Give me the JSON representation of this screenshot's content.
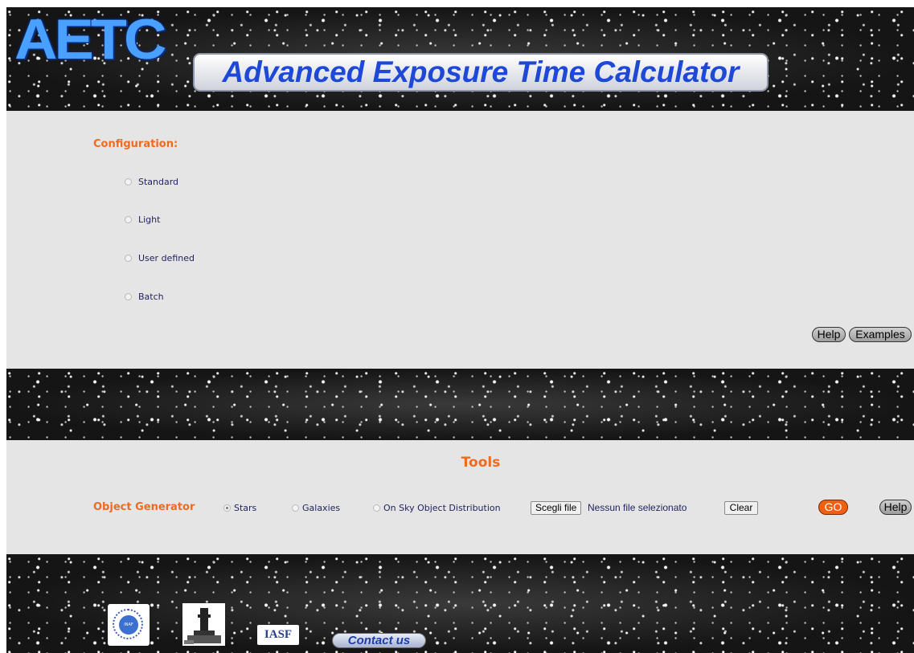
{
  "header": {
    "logo_text": "AETC",
    "title": "Advanced Exposure Time Calculator"
  },
  "configuration": {
    "heading": "Configuration:",
    "options": [
      {
        "label": "Standard",
        "checked": false
      },
      {
        "label": "Light",
        "checked": false
      },
      {
        "label": "User defined",
        "checked": false
      },
      {
        "label": "Batch",
        "checked": false
      }
    ],
    "help_label": "Help",
    "examples_label": "Examples"
  },
  "tools": {
    "heading": "Tools",
    "object_generator_label": "Object Generator",
    "options": [
      {
        "label": "Stars",
        "checked": true
      },
      {
        "label": "Galaxies",
        "checked": false
      },
      {
        "label": "On Sky Object Distribution",
        "checked": false
      }
    ],
    "choose_file_label": "Scegli file",
    "no_file_label": "Nessun file selezionato",
    "clear_label": "Clear",
    "go_label": "GO",
    "help_label": "Help"
  },
  "footer": {
    "logo1": "INAF",
    "logo3": "IASF",
    "contact_label": "Contact us"
  },
  "colors": {
    "accent_orange": "#ee6b1f",
    "title_blue": "#1e48d6",
    "panel_gray": "#e5e5e5"
  }
}
